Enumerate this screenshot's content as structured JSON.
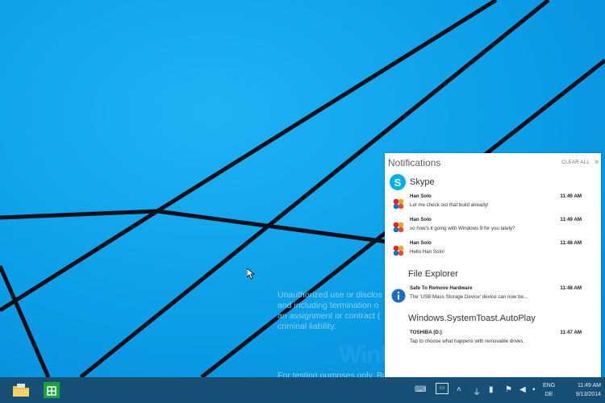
{
  "desktop": {
    "legal_lines": [
      "Unauthorized use or disclos",
      "and including termination o",
      "an assignment or contract (",
      "criminal liability."
    ],
    "testing_text": "For testing purposes only. Bui",
    "watermark": "WinFuture"
  },
  "notifications": {
    "title": "Notifications",
    "clear_all": "CLEAR ALL",
    "close_symbol": "»",
    "groups": [
      {
        "app": "Skype",
        "icon": "skype-icon",
        "items": [
          {
            "sender": "Han Solo",
            "message": "Let me check out that build already!",
            "time": "11:49 AM"
          },
          {
            "sender": "Han Solo",
            "message": "so how's it going with Windows 9 for you lately?",
            "time": "11:49 AM"
          },
          {
            "sender": "Han Solo",
            "message": "Hello Han Solo!",
            "time": "11:48 AM"
          }
        ]
      },
      {
        "app": "File Explorer",
        "icon": "info-icon",
        "items": [
          {
            "sender": "Safe To Remove Hardware",
            "message": "The 'USB Mass Storage Device' device can now be...",
            "time": "11:48 AM"
          }
        ]
      },
      {
        "app": "Windows.SystemToast.AutoPlay",
        "icon": "",
        "items": [
          {
            "sender": "TOSHIBA (D:)",
            "message": "Tap to choose what happens with removable drives.",
            "time": "11:47 AM"
          }
        ]
      }
    ]
  },
  "taskbar": {
    "pinned": [
      "file-explorer-icon",
      "store-icon"
    ],
    "tray_icons": [
      "keyboard-icon",
      "action-center-icon",
      "chevron-up-icon",
      "network-icon",
      "battery-icon",
      "flag-icon",
      "volume-icon",
      "input-icon"
    ],
    "language_line1": "ENG",
    "language_line2": "DE",
    "time": "11:49 AM",
    "date": "9/13/2014"
  },
  "colors": {
    "desktop": "#0d9fe8",
    "taskbar": "#174f77",
    "skype": "#00aff0",
    "info": "#1a6fc0"
  }
}
